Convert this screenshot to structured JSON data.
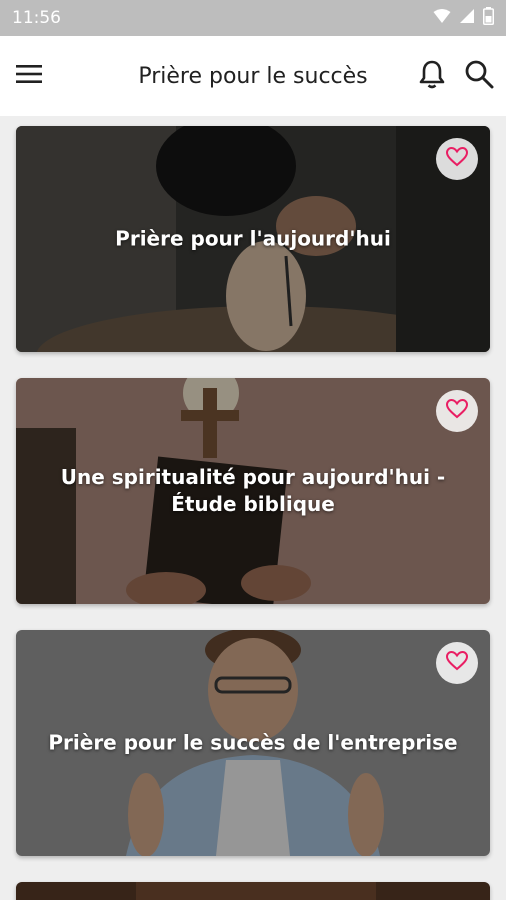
{
  "status_bar": {
    "time": "11:56",
    "icons": [
      "wifi-icon",
      "signal-icon",
      "battery-icon"
    ]
  },
  "app_bar": {
    "title": "Prière pour le succès",
    "icons": [
      "menu-icon",
      "bell-icon",
      "search-icon"
    ]
  },
  "cards": [
    {
      "title": "Prière pour l'aujourd'hui",
      "favorite": false,
      "image": "praying-hands-rosary"
    },
    {
      "title": "Une spiritualité pour aujourd'hui - Étude biblique",
      "favorite": false,
      "image": "bible-and-cross"
    },
    {
      "title": "Prière pour le succès de l'entreprise",
      "favorite": false,
      "image": "man-fingers-crossed"
    }
  ],
  "colors": {
    "accent": "#e91e63",
    "status_bar": "#bdbdbd",
    "app_bar": "#ffffff",
    "background": "#eeeeee"
  }
}
